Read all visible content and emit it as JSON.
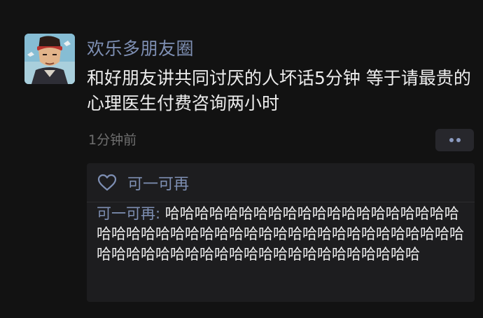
{
  "post": {
    "author": "欢乐多朋友圈",
    "content": "和好朋友讲共同讨厌的人坏话5分钟 等于请最贵的心理医生付费咨询两小时",
    "time": "1分钟前",
    "more_icon": "more-dots-icon"
  },
  "likes": {
    "icon": "heart-outline-icon",
    "names": "可一可再"
  },
  "comments": [
    {
      "author": "可一可再",
      "separator": ": ",
      "text": "哈哈哈哈哈哈哈哈哈哈哈哈哈哈哈哈哈哈哈哈哈哈哈哈哈哈哈哈哈哈哈哈哈哈哈哈哈哈哈哈哈哈哈哈哈哈哈哈哈哈哈哈哈哈哈哈哈哈哈哈哈哈哈哈哈哈哈"
    }
  ],
  "colors": {
    "background": "#121212",
    "name_link": "#7e8fb3",
    "text": "#ededed",
    "muted": "#6f6f6f",
    "panel": "#1d1d1f"
  }
}
